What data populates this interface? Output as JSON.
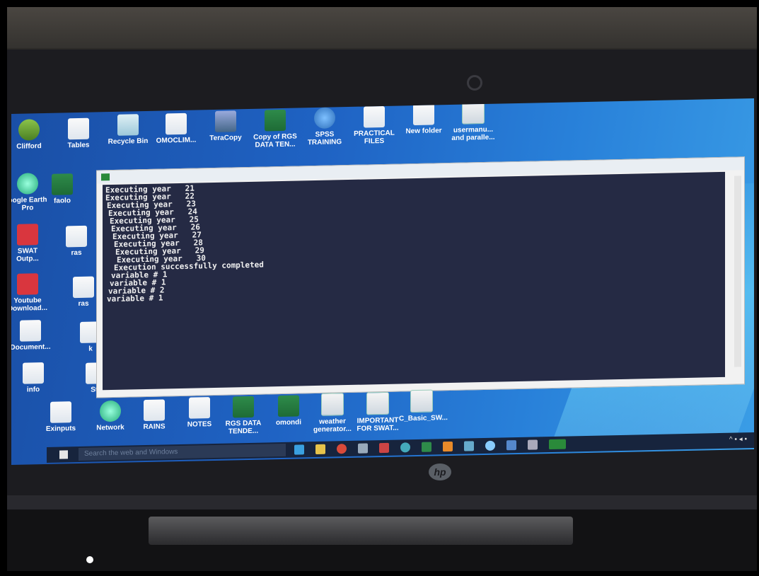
{
  "desktop_icons_top": [
    "Clifford",
    "Tables",
    "Recycle Bin",
    "OMOCLIM...",
    "TeraCopy",
    "Copy of RGS\nDATA TEN...",
    "SPSS\nTRAINING",
    "PRACTICAL\nFILES",
    "New folder",
    "usermanu...\nand paralle..."
  ],
  "desktop_icons_left": [
    "oogle Earth\nPro",
    "SWAT\nOutp...",
    "Youtube\nDownload...",
    "Document...",
    "info"
  ],
  "desktop_icons_left2": [
    "faolo",
    "ras",
    "ras",
    "k",
    "Sta"
  ],
  "desktop_icons_bottom": [
    "Exinputs",
    "Network",
    "RAINS",
    "NOTES",
    "RGS DATA\nTENDE...",
    "omondi",
    "weather\ngenerator...",
    "IMPORTANT\nFOR SWAT...",
    "C_Basic_SW..."
  ],
  "console": {
    "lines": [
      "Executing year   21",
      "Executing year   22",
      "Executing year   23",
      "Executing year   24",
      "Executing year   25",
      "Executing year   26",
      "Executing year   27",
      "Executing year   28",
      "Executing year   29",
      "Executing year   30",
      "",
      "Execution successfully completed",
      "variable # 1",
      "variable # 1",
      "variable # 2",
      "variable # 1"
    ]
  },
  "taskbar": {
    "search_placeholder": "Search the web and Windows"
  },
  "brand": "hp"
}
